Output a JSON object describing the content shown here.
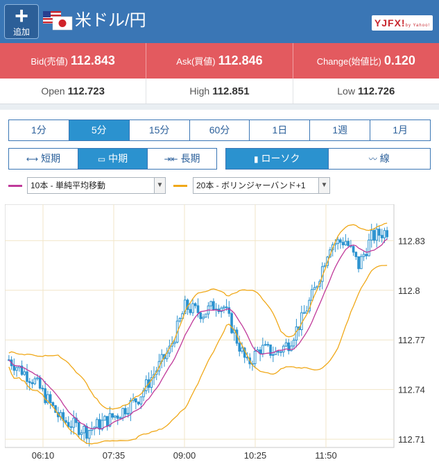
{
  "header": {
    "add_label": "追加",
    "pair_title": "米ドル/円",
    "logo_text": "YJFX!",
    "logo_sub": "by Yahoo!"
  },
  "quotes": {
    "bid_label": "Bid(売値)",
    "bid_value": "112.843",
    "ask_label": "Ask(買値)",
    "ask_value": "112.846",
    "change_label": "Change(始値比)",
    "change_value": "0.120"
  },
  "ohl": {
    "open_label": "Open",
    "open_value": "112.723",
    "high_label": "High",
    "high_value": "112.851",
    "low_label": "Low",
    "low_value": "112.726"
  },
  "timeframes": [
    {
      "label": "1分",
      "active": false
    },
    {
      "label": "5分",
      "active": true
    },
    {
      "label": "15分",
      "active": false
    },
    {
      "label": "60分",
      "active": false
    },
    {
      "label": "1日",
      "active": false
    },
    {
      "label": "1週",
      "active": false
    },
    {
      "label": "1月",
      "active": false
    }
  ],
  "periods": [
    {
      "label": "短期",
      "icon": "expand-icon",
      "active": false
    },
    {
      "label": "中期",
      "icon": "window-icon",
      "active": true
    },
    {
      "label": "長期",
      "icon": "compress-icon",
      "active": false
    }
  ],
  "chart_types": [
    {
      "label": "ローソク",
      "icon": "candlestick-icon",
      "active": true
    },
    {
      "label": "線",
      "icon": "line-icon",
      "active": false
    }
  ],
  "indicators": [
    {
      "label": "10本 - 単純平均移動",
      "color": "#c0399a"
    },
    {
      "label": "20本 - ボリンジャーバンド+1",
      "color": "#f0a818"
    }
  ],
  "colors": {
    "header": "#3a76b5",
    "quote_bar": "#e35a5f",
    "active": "#2b92cf",
    "candle": "#2b92cf",
    "ma": "#c0399a",
    "bb": "#f0a818"
  },
  "chart_data": {
    "type": "candlestick",
    "x_ticks": [
      "06:10",
      "07:35",
      "09:00",
      "10:25",
      "11:50"
    ],
    "y_ticks": [
      "112.71",
      "112.74",
      "112.77",
      "112.8",
      "112.83"
    ],
    "ylim": [
      112.705,
      112.852
    ],
    "grid": true,
    "series": [
      {
        "name": "10本 - 単純平均移動"
      },
      {
        "name": "20本 - ボリンジャーバンド+1"
      }
    ]
  }
}
